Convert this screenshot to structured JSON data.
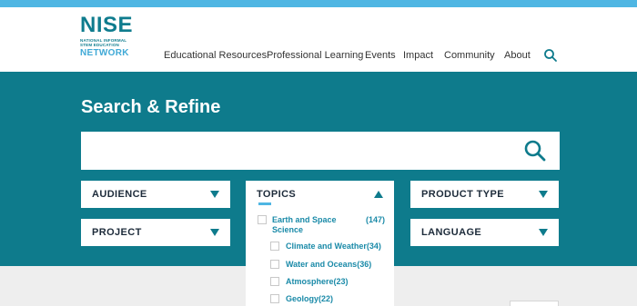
{
  "brand": {
    "name": "NISE",
    "tagline_line1": "NATIONAL INFORMAL",
    "tagline_line2": "STEM EDUCATION",
    "network": "NETWORK",
    "primary_color": "#0e7b8c",
    "accent_color": "#4fb6e3"
  },
  "nav": {
    "items": [
      "Educational Resources",
      "Professional Learning",
      "Events",
      "Impact",
      "Community",
      "About"
    ],
    "search_icon": "search-icon"
  },
  "hero": {
    "title": "Search & Refine",
    "search_value": "",
    "search_placeholder": ""
  },
  "filters": {
    "audience": "AUDIENCE",
    "project": "PROJECT",
    "topics": "TOPICS",
    "product_type": "PRODUCT TYPE",
    "language": "LANGUAGE"
  },
  "topics": {
    "parent": {
      "label_line1": "Earth and Space",
      "label_line2": "Science",
      "count": "(147)"
    },
    "children": [
      {
        "label": "Climate and Weather",
        "count": "(34)"
      },
      {
        "label": "Water and Oceans",
        "count": "(36)"
      },
      {
        "label": "Atmosphere",
        "count": "(23)"
      },
      {
        "label": "Geology",
        "count": "(22)"
      }
    ]
  }
}
